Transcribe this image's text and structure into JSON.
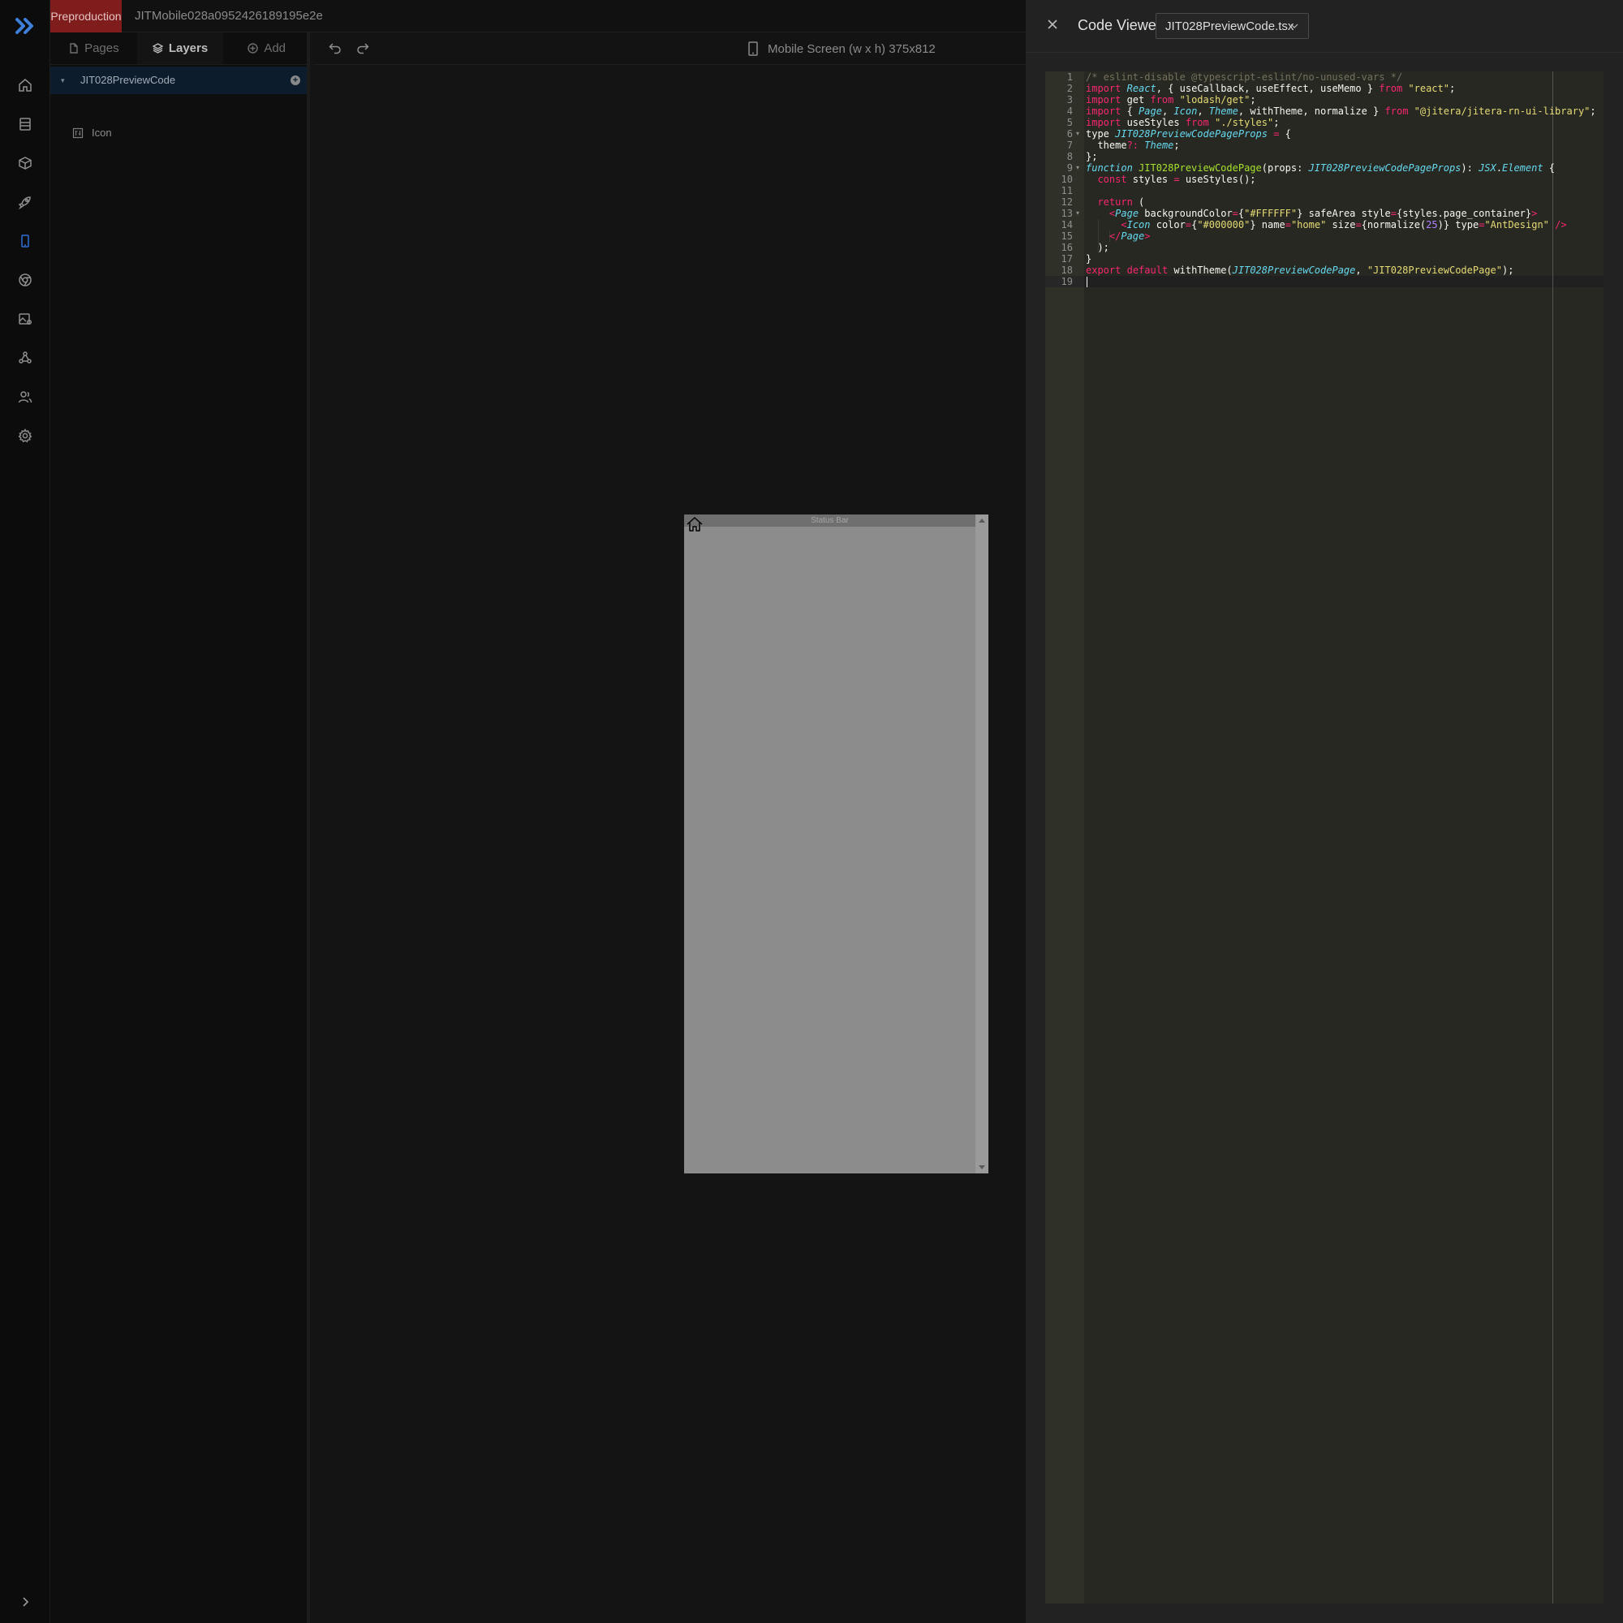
{
  "app": {
    "environment_badge": "Preproduction",
    "project_name": "JITMobile028a0952426189195e2e"
  },
  "rail": {
    "items": [
      {
        "icon": "home-icon"
      },
      {
        "icon": "database-icon"
      },
      {
        "icon": "cube-icon"
      },
      {
        "icon": "rocket-icon"
      },
      {
        "icon": "mobile-icon"
      },
      {
        "icon": "chrome-icon"
      },
      {
        "icon": "image-settings-icon"
      },
      {
        "icon": "webhook-icon"
      },
      {
        "icon": "users-icon"
      },
      {
        "icon": "gear-icon"
      }
    ],
    "active_index": 4
  },
  "left_panel": {
    "tabs": [
      {
        "label": "Pages",
        "icon": "file-icon"
      },
      {
        "label": "Layers",
        "icon": "layers-icon"
      },
      {
        "label": "Add",
        "icon": "plus-circle-icon"
      }
    ],
    "active_tab": "Layers",
    "tree": {
      "root": "JIT028PreviewCode",
      "children": [
        "Icon"
      ]
    }
  },
  "canvas": {
    "screen_label": "Mobile Screen (w x h) 375x812",
    "phone": {
      "status_bar": "Status Bar",
      "background": "#8C8C8C"
    }
  },
  "code_viewer": {
    "title": "Code Viewer",
    "file": "JIT028PreviewCode.tsx",
    "line_numbers": [
      "1",
      "2",
      "3",
      "4",
      "5",
      "6",
      "7",
      "8",
      "9",
      "10",
      "11",
      "12",
      "13",
      "14",
      "15",
      "16",
      "17",
      "18",
      "19"
    ],
    "colors": {
      "keyword": "#f92672",
      "string": "#e6db74",
      "comment": "#75715e",
      "type": "#66d9ef",
      "function": "#a6e22e",
      "number": "#ae81ff",
      "plain": "#f8f8f2"
    }
  }
}
